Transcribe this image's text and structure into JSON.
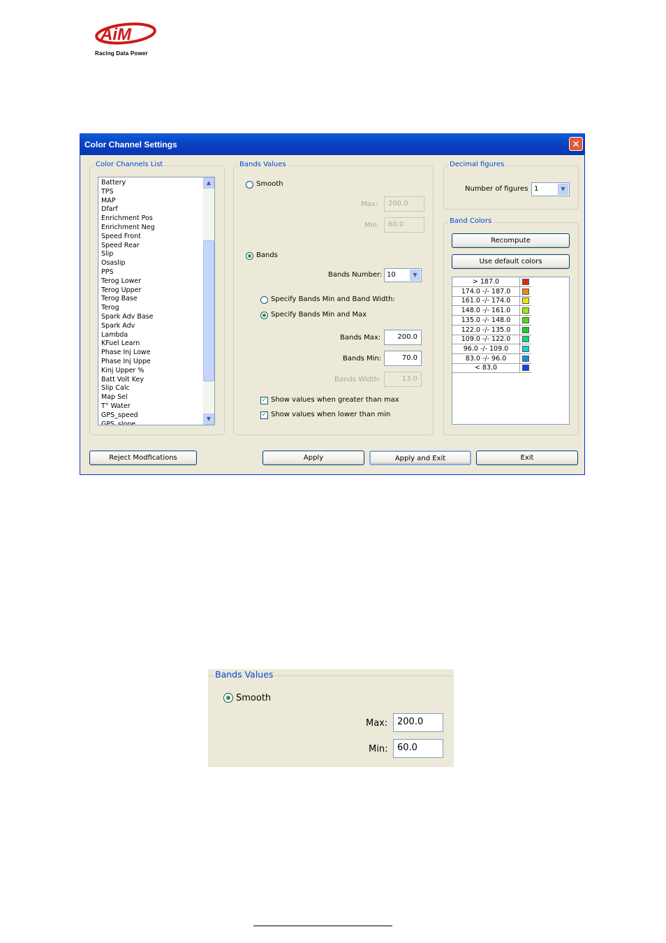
{
  "logo": {
    "brand": "AiM",
    "tagline": "Racing Data Power"
  },
  "dialog": {
    "title": "Color Channel Settings",
    "close": "✕",
    "channels_list": {
      "label": "Color Channels List",
      "items": [
        "Battery",
        "TPS",
        "MAP",
        "Dfarf",
        "Enrichment Pos",
        "Enrichment Neg",
        "Speed Front",
        "Speed Rear",
        "Slip",
        "Osaslip",
        "PPS",
        "Terog Lower",
        "Terog Upper",
        "Terog Base",
        "Terog",
        "Spark Adv Base",
        "Spark Adv",
        "Lambda",
        "KFuel Learn",
        "Phase Inj Lowe",
        "Phase Inj Uppe",
        "Kinj Upper %",
        "Batt Volt Key",
        "Slip Calc",
        "Map Sel",
        "T° Water",
        "GPS_speed",
        "GPS_slope"
      ]
    },
    "bands_values": {
      "label": "Bands Values",
      "smooth_label": "Smooth",
      "smooth_selected": false,
      "max_label": "Max:",
      "max_value": "200.0",
      "min_label": "Min:",
      "min_value": "60.0",
      "bands_label": "Bands",
      "bands_selected": true,
      "bands_number_label": "Bands Number:",
      "bands_number_value": "10",
      "option_width_label": "Specify Bands Min and Band Width:",
      "option_width_selected": false,
      "option_minmax_label": "Specify Bands Min and Max",
      "option_minmax_selected": true,
      "bands_max_label": "Bands Max:",
      "bands_max_value": "200.0",
      "bands_min_label": "Bands Min:",
      "bands_min_value": "70.0",
      "bands_width_label": "Bands Width:",
      "bands_width_value": "13.0",
      "show_greater_label": "Show values when greater than max",
      "show_greater_checked": true,
      "show_lower_label": "Show values when lower than min",
      "show_lower_checked": true
    },
    "decimal_figures": {
      "label": "Decimal figures",
      "number_label": "Number of figures",
      "number_value": "1"
    },
    "band_colors": {
      "label": "Band Colors",
      "recompute": "Recompute",
      "use_default": "Use default colors",
      "rows": [
        {
          "label": "> 187.0",
          "color": "#e8260c"
        },
        {
          "label": "174.0 -/- 187.0",
          "color": "#f08a0c"
        },
        {
          "label": "161.0 -/- 174.0",
          "color": "#f2e60c"
        },
        {
          "label": "148.0 -/- 161.0",
          "color": "#a6e40c"
        },
        {
          "label": "135.0 -/- 148.0",
          "color": "#52d80c"
        },
        {
          "label": "122.0 -/- 135.0",
          "color": "#10d424"
        },
        {
          "label": "109.0 -/- 122.0",
          "color": "#10d47c"
        },
        {
          "label": "96.0 -/- 109.0",
          "color": "#10d4cc"
        },
        {
          "label": "83.0 -/- 96.0",
          "color": "#1a8ae8"
        },
        {
          "label": "< 83.0",
          "color": "#1a3ee8"
        }
      ]
    },
    "buttons": {
      "reject": "Reject Modfications",
      "apply": "Apply",
      "apply_exit": "Apply and Exit",
      "exit": "Exit"
    }
  },
  "crop": {
    "label": "Bands Values",
    "smooth_label": "Smooth",
    "max_label": "Max:",
    "max_value": "200.0",
    "min_label": "Min:",
    "min_value": "60.0"
  }
}
